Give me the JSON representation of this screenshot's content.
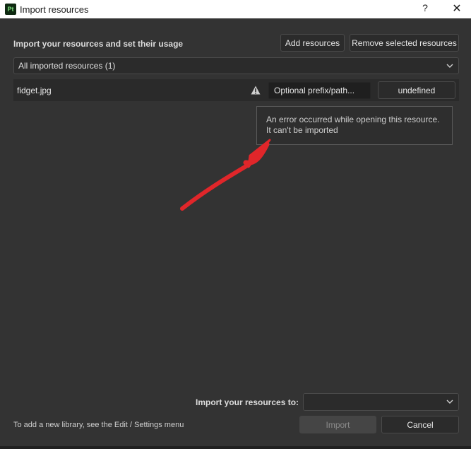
{
  "window": {
    "app_badge": "Pt",
    "title": "Import resources",
    "help_label": "?",
    "close_label": "✕"
  },
  "header": {
    "heading": "Import your resources and set their usage",
    "add_button": "Add resources",
    "remove_button": "Remove selected resources"
  },
  "filter": {
    "selected": "All imported resources (1)"
  },
  "resources": [
    {
      "filename": "fidget.jpg",
      "status_icon": "warning-icon",
      "prefix_placeholder": "Optional prefix/path...",
      "usage_button": "undefined"
    }
  ],
  "tooltip": {
    "line1": "An error occurred while opening this resource.",
    "line2": "It can't be imported"
  },
  "footer": {
    "import_to_label": "Import your resources to:",
    "import_to_selected": "",
    "note": "To add a new library, see the Edit / Settings menu",
    "import_button": "Import",
    "cancel_button": "Cancel"
  },
  "colors": {
    "background": "#333333",
    "annotation_arrow": "#e0262a"
  }
}
